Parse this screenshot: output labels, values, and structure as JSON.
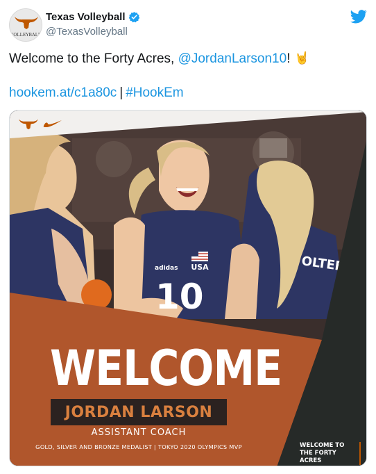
{
  "account": {
    "display_name": "Texas Volleyball",
    "handle": "@TexasVolleyball",
    "avatar_text": "VOLLEYBALL"
  },
  "tweet": {
    "text_prefix": "Welcome to the Forty Acres, ",
    "mention": "@JordanLarson10",
    "text_suffix": "!",
    "emoji": "🤘",
    "link": "hookem.at/c1a80c",
    "separator": "|",
    "hashtag": "#HookEm"
  },
  "graphic": {
    "headline": "WELCOME",
    "person_name": "JORDAN LARSON",
    "role": "ASSISTANT COACH",
    "honors": "GOLD, SILVER AND BRONZE MEDALIST | TOKYO 2020 OLYMPICS MVP",
    "tagline": "WELCOME TO THE FORTY ACRES",
    "jersey_number": "10",
    "jersey_text": "USA",
    "jersey_brand": "adidas",
    "back_name": "OLTEF"
  },
  "colors": {
    "burnt_orange": "#bf5700",
    "graphic_orange": "#b0562c",
    "jersey_navy": "#2d3563",
    "twitter_blue": "#1da1f2",
    "link_blue": "#1b95e0"
  },
  "icons": {
    "verified": "verified-badge-icon",
    "twitter": "twitter-bird-icon",
    "longhorn": "longhorn-logo-icon",
    "nike": "nike-swoosh-icon"
  }
}
